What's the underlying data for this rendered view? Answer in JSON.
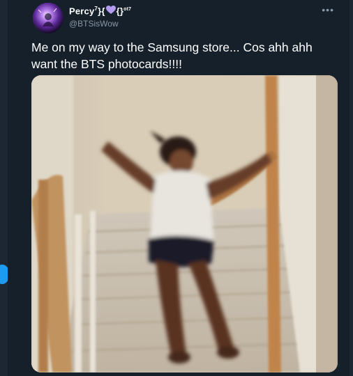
{
  "tweet": {
    "display_name_prefix": "Percy",
    "display_name_sup": "7",
    "display_name_suffix_a": "}{",
    "display_name_suffix_b": "{}",
    "display_name_sup2": "ot7",
    "handle": "@BTSisWow",
    "text": "Me on my way to the Samsung store... Cos ahh ahh want the BTS photocards!!!!",
    "more_icon": "more-options-icon",
    "media_alt": "photo"
  },
  "colors": {
    "background": "#15202b",
    "text_primary": "#ffffff",
    "text_secondary": "#8899a6",
    "accent": "#1d9bf0",
    "heart": "#b49cf0"
  }
}
